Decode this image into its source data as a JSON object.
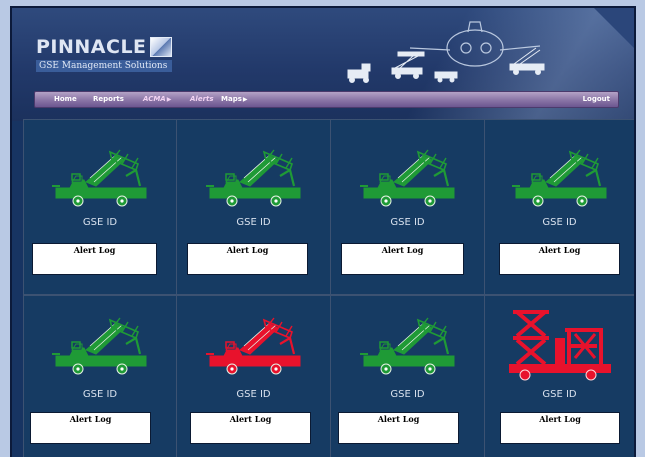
{
  "header": {
    "logo_word": "PINNACLE",
    "logo_subtitle": "GSE Management Solutions"
  },
  "nav": {
    "items": [
      {
        "label": "Home",
        "has_submenu": false
      },
      {
        "label": "Reports",
        "has_submenu": false
      },
      {
        "label": "ACMA",
        "has_submenu": true
      },
      {
        "label": "Alerts",
        "has_submenu": false
      },
      {
        "label": "Maps",
        "has_submenu": true
      }
    ],
    "logout_label": "Logout",
    "submenu_arrow": "▶"
  },
  "tiles": [
    {
      "id_label": "GSE ID",
      "log_label": "Alert Log",
      "vehicle": "stair-truck",
      "status_color": "#1f9a36"
    },
    {
      "id_label": "GSE ID",
      "log_label": "Alert Log",
      "vehicle": "stair-truck",
      "status_color": "#1f9a36"
    },
    {
      "id_label": "GSE ID",
      "log_label": "Alert Log",
      "vehicle": "stair-truck",
      "status_color": "#1f9a36"
    },
    {
      "id_label": "GSE ID",
      "log_label": "Alert Log",
      "vehicle": "stair-truck",
      "status_color": "#1f9a36"
    },
    {
      "id_label": "GSE ID",
      "log_label": "Alert Log",
      "vehicle": "stair-truck",
      "status_color": "#1f9a36"
    },
    {
      "id_label": "GSE ID",
      "log_label": "Alert Log",
      "vehicle": "stair-truck",
      "status_color": "#e8122c"
    },
    {
      "id_label": "GSE ID",
      "log_label": "Alert Log",
      "vehicle": "stair-truck",
      "status_color": "#1f9a36"
    },
    {
      "id_label": "GSE ID",
      "log_label": "Alert Log",
      "vehicle": "scissor-lift-truck",
      "status_color": "#e8122c"
    }
  ]
}
